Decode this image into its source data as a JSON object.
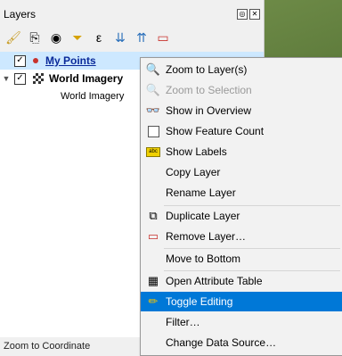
{
  "panel": {
    "title": "Layers",
    "float_btn": "◎",
    "close_btn": "✕",
    "toolbar": [
      {
        "name": "style-brush-icon",
        "glyph": "🖌"
      },
      {
        "name": "add-group-icon",
        "glyph": "⎘"
      },
      {
        "name": "eye-icon",
        "glyph": "👁"
      },
      {
        "name": "filter-icon",
        "glyph": "⏷"
      },
      {
        "name": "expression-filter-icon",
        "glyph": "ε"
      },
      {
        "name": "expand-all-icon",
        "glyph": "⇊"
      },
      {
        "name": "collapse-all-icon",
        "glyph": "⇈"
      },
      {
        "name": "remove-layer-icon",
        "glyph": "▭"
      }
    ]
  },
  "layers": {
    "my_points": "My Points",
    "world_imagery_group": "World Imagery",
    "world_imagery_child": "World Imagery"
  },
  "status": "Zoom to Coordinate",
  "menu": {
    "zoom_layer": "Zoom to Layer(s)",
    "zoom_selection": "Zoom to Selection",
    "show_overview": "Show in Overview",
    "show_feature_count": "Show Feature Count",
    "show_labels": "Show Labels",
    "copy_layer": "Copy Layer",
    "rename_layer": "Rename Layer",
    "duplicate_layer": "Duplicate Layer",
    "remove_layer": "Remove Layer…",
    "move_bottom": "Move to Bottom",
    "open_attr": "Open Attribute Table",
    "toggle_editing": "Toggle Editing",
    "filter": "Filter…",
    "change_source": "Change Data Source…"
  },
  "colors": {
    "highlight": "#0078d7",
    "selection": "#cde8ff"
  }
}
